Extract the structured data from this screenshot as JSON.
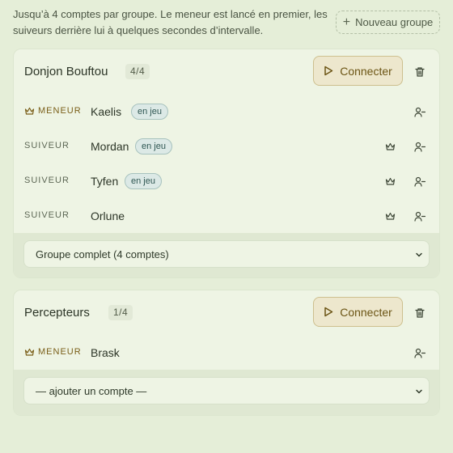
{
  "intro_text": "Jusqu’à 4 comptes par groupe. Le meneur est lancé en premier, les suiveurs derrière lui à quelques secondes d’intervalle.",
  "new_group_label": "Nouveau groupe",
  "connect_label": "Connecter",
  "ingame_label": "en jeu",
  "roles": {
    "leader": "MENEUR",
    "follower": "SUIVEUR"
  },
  "colors": {
    "background": "#e5eed8",
    "accent": "#7a5e18",
    "badge": "#2f5753"
  },
  "groups": [
    {
      "name": "Donjon Bouftou",
      "count": "4/4",
      "members": [
        {
          "role": "MENEUR",
          "name": "Kaelis",
          "status": "en jeu"
        },
        {
          "role": "SUIVEUR",
          "name": "Mordan",
          "status": "en jeu"
        },
        {
          "role": "SUIVEUR",
          "name": "Tyfen",
          "status": "en jeu"
        },
        {
          "role": "SUIVEUR",
          "name": "Orlune",
          "status": ""
        }
      ],
      "select_value": "Groupe complet (4 comptes)"
    },
    {
      "name": "Percepteurs",
      "count": "1/4",
      "members": [
        {
          "role": "MENEUR",
          "name": "Brask",
          "status": ""
        }
      ],
      "select_value": "— ajouter un compte —"
    }
  ]
}
